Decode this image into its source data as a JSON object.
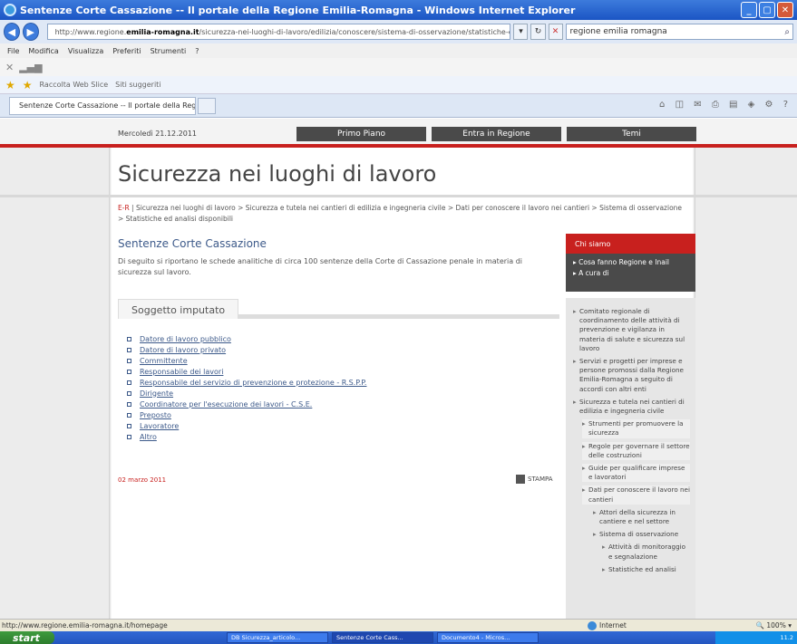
{
  "window": {
    "title": "Sentenze Corte Cassazione -- Il portale della Regione Emilia-Romagna - Windows Internet Explorer"
  },
  "address": {
    "prefix": "http://www.regione.",
    "domain": "emilia-romagna.it",
    "path": "/sicurezza-nei-luoghi-di-lavoro/edilizia/conoscere/sistema-di-osservazione/statistiche-ed-analisi-disponibili/sentenze"
  },
  "search": {
    "value": "regione emilia romagna"
  },
  "menu": [
    "File",
    "Modifica",
    "Visualizza",
    "Preferiti",
    "Strumenti",
    "?"
  ],
  "favorites": {
    "web_slice": "Raccolta Web Slice",
    "suggested": "Siti suggeriti"
  },
  "tab": {
    "label": "Sentenze Corte Cassazione -- Il portale della Regione..."
  },
  "site": {
    "date": "Mercoledì 21.12.2011",
    "nav": [
      "Primo Piano",
      "Entra in Regione",
      "Temi"
    ],
    "page_title": "Sicurezza nei luoghi di lavoro",
    "breadcrumb_er": "E-R",
    "breadcrumb_rest": " | Sicurezza nei luoghi di lavoro > Sicurezza e tutela nei cantieri di edilizia e ingegneria civile > Dati per conoscere il lavoro nei cantieri > Sistema di osservazione > Statistiche ed analisi disponibili",
    "section_title": "Sentenze Corte Cassazione",
    "intro": "Di seguito si riportano le schede analitiche di circa 100 sentenze della Corte di Cassazione penale in materia di sicurezza sul lavoro.",
    "subject_heading": "Soggetto imputato",
    "links": [
      "Datore di lavoro pubblico",
      "Datore di lavoro privato",
      "Committente",
      "Responsabile dei lavori",
      "Responsabile del servizio di prevenzione e protezione - R.S.P.P.",
      "Dirigente",
      "Coordinatore per l'esecuzione dei lavori - C.S.E.",
      "Preposto",
      "Lavoratore",
      "Altro"
    ],
    "pub_date": "02 marzo 2011",
    "print_label": "STAMPA",
    "chi_siamo": "Chi siamo",
    "chi_links": [
      "Cosa fanno Regione e Inail",
      "A cura di"
    ],
    "right_items": [
      "Comitato regionale di coordinamento delle attività di prevenzione e vigilanza in materia di salute e sicurezza sul lavoro",
      "Servizi e progetti per imprese e persone promossi dalla Regione Emilia-Romagna a seguito di accordi con altri enti",
      "Sicurezza e tutela nei cantieri di edilizia e ingegneria civile"
    ],
    "right_sub": [
      "Strumenti per promuovere la sicurezza",
      "Regole per governare il settore delle costruzioni",
      "Guide per qualificare imprese e lavoratori",
      "Dati per conoscere il lavoro nei cantieri"
    ],
    "right_sub2": [
      "Attori della sicurezza in cantiere e nel settore",
      "Sistema di osservazione"
    ],
    "right_sub3": [
      "Attività di monitoraggio e segnalazione",
      "Statistiche ed analisi"
    ]
  },
  "status": {
    "url": "http://www.regione.emilia-romagna.it/homepage",
    "zone": "Internet",
    "zoom": "100%"
  },
  "taskbar": {
    "start": "start",
    "items": [
      "DB Sicurezza_articolo...",
      "Sentenze Corte Cass...",
      "Documento4 - Micros..."
    ],
    "clock": "11.2"
  }
}
